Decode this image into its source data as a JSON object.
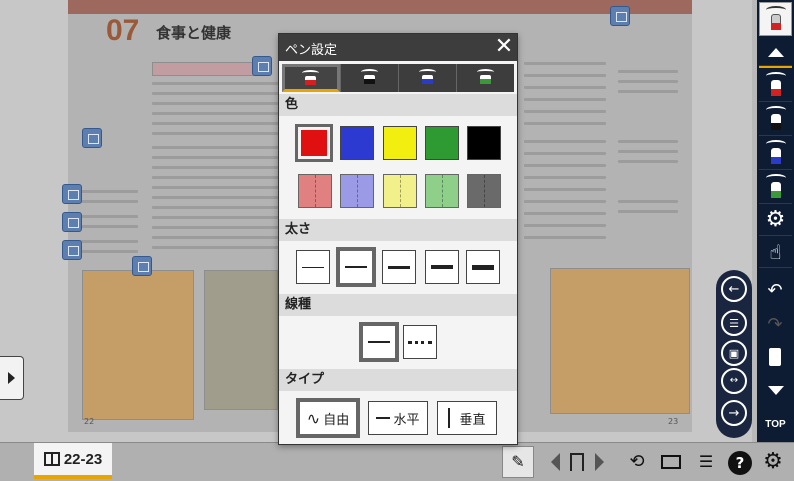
{
  "book": {
    "chapter_number": "07",
    "chapter_title": "食事と健康",
    "left_page_number": "22",
    "right_page_number": "23"
  },
  "dialog": {
    "title": "ペン設定",
    "close_label": "✕",
    "pen_tabs": [
      {
        "name": "pen-1",
        "tip_color": "#d32020",
        "selected": true
      },
      {
        "name": "pen-2",
        "tip_color": "#111111",
        "selected": false
      },
      {
        "name": "pen-3",
        "tip_color": "#2a3bc8",
        "selected": false
      },
      {
        "name": "pen-4",
        "tip_color": "#3a9a3a",
        "selected": false
      }
    ],
    "color_section": {
      "label": "色",
      "colors": [
        "#e01010",
        "#2d3ad2",
        "#f2ee10",
        "#2e9a32",
        "#000000"
      ],
      "light_colors": [
        "#e08080",
        "#9a9ae6",
        "#f2f08a",
        "#8ecf8a",
        "#6a6a6a"
      ],
      "selected_index": 0
    },
    "thickness_section": {
      "label": "太さ",
      "options": [
        1,
        2,
        3,
        4,
        5
      ],
      "selected_index": 1
    },
    "linetype_section": {
      "label": "線種",
      "options": [
        "solid",
        "dotted"
      ],
      "selected_index": 0
    },
    "type_section": {
      "label": "タイプ",
      "options": [
        {
          "id": "free",
          "label": "自由"
        },
        {
          "id": "horizontal",
          "label": "水平"
        },
        {
          "id": "vertical",
          "label": "垂直"
        }
      ],
      "selected_index": 0
    }
  },
  "bottom_bar": {
    "page_label": "22-23",
    "help_label": "?"
  },
  "right_toolbar": {
    "top_label": "TOP",
    "pen_colors": [
      "#d32020",
      "#111111",
      "#2a3bc8",
      "#3a9a3a"
    ]
  },
  "colors": {
    "accent": "#e8a400",
    "toolbar_bg": "#0d1b33",
    "dialog_header": "#3d3d3d"
  }
}
